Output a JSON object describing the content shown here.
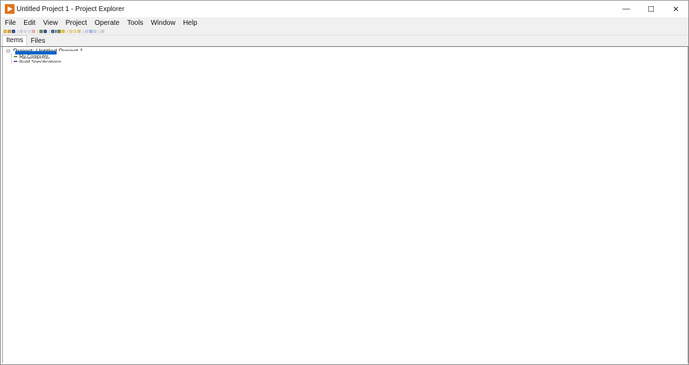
{
  "window": {
    "title": "Untitled Project 1 - Project Explorer",
    "controls": {
      "minimize": "—",
      "maximize": "☐",
      "close": "✕"
    }
  },
  "menubar": [
    "File",
    "Edit",
    "View",
    "Project",
    "Operate",
    "Tools",
    "Window",
    "Help"
  ],
  "toolbar": {
    "groups": [
      [
        "new-icon",
        "open-icon",
        "save-all-icon"
      ],
      [
        "cut-icon",
        "copy-icon",
        "paste-icon",
        "delete-icon"
      ],
      [
        "import-icon",
        "export-icon"
      ],
      [
        "add-item-icon",
        "dropdown-icon",
        "properties-icon",
        "warning-icon"
      ],
      [
        "folder-icon",
        "folder-open-icon",
        "folder-add-icon"
      ],
      [
        "find-icon",
        "refresh-icon",
        "expand-icon"
      ],
      [
        "collapse-icon"
      ]
    ]
  },
  "tabs": [
    {
      "label": "Items",
      "active": true
    },
    {
      "label": "Files",
      "active": false
    }
  ],
  "tree": {
    "items": [
      {
        "label": "Project: Untitled Project 1",
        "level": 0,
        "expanded": true
      },
      {
        "label": "My Computer",
        "level": 1,
        "selected": true
      },
      {
        "label": "Dependencies",
        "level": 2
      },
      {
        "label": "Build Specifications",
        "level": 2
      }
    ]
  }
}
